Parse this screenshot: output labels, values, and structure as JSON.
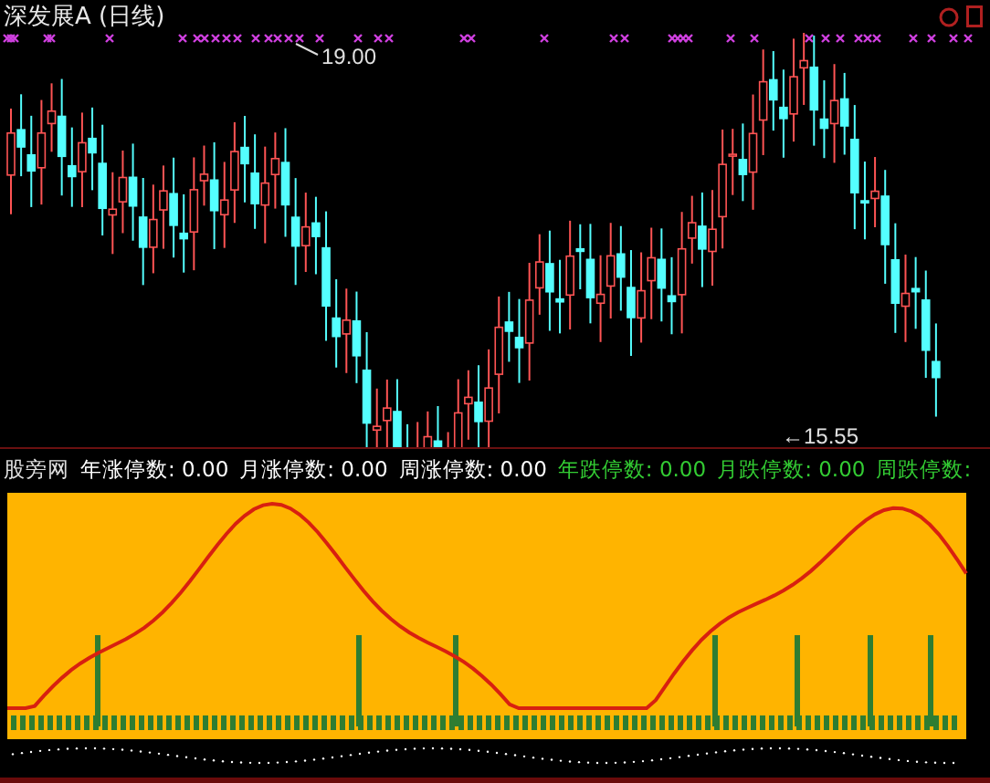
{
  "chart": {
    "title": "深发展A (日线)",
    "price_labels": [
      {
        "kind": "high",
        "text": "19.00"
      },
      {
        "kind": "low",
        "text": "←15.55"
      }
    ]
  },
  "indicator": {
    "name": "股旁网",
    "fields": [
      {
        "text": "年涨停数: 0.00",
        "color": "#ffffff"
      },
      {
        "text": "月涨停数: 0.00",
        "color": "#ffffff"
      },
      {
        "text": "周涨停数: 0.00",
        "color": "#ffffff"
      },
      {
        "text": "年跌停数: 0.00",
        "color": "#33cc33"
      },
      {
        "text": "月跌停数: 0.00",
        "color": "#33cc33"
      },
      {
        "text": "周跌停数:",
        "color": "#33cc33"
      }
    ]
  }
}
